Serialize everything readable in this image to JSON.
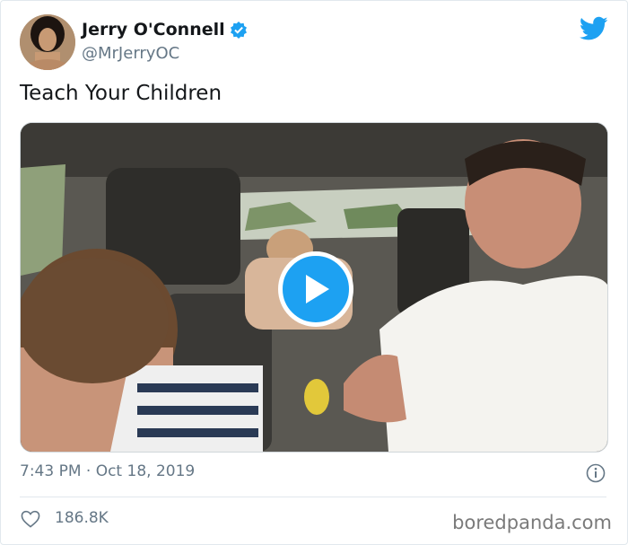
{
  "tweet": {
    "author": {
      "display_name": "Jerry O'Connell",
      "handle": "@MrJerryOC",
      "verified": true,
      "avatar_icon": "profile-photo"
    },
    "text": "Teach Your Children",
    "media": {
      "type": "video",
      "play_icon": "play-icon"
    },
    "timestamp": "7:43 PM · Oct 18, 2019",
    "likes": "186.8K"
  },
  "icons": {
    "brand": "twitter-bird-icon",
    "verified": "verified-badge-icon",
    "info": "info-icon",
    "like": "heart-icon"
  },
  "colors": {
    "brand_blue": "#1da1f2",
    "secondary_text": "#657786",
    "primary_text": "#14171a"
  },
  "watermark": "boredpanda.com"
}
